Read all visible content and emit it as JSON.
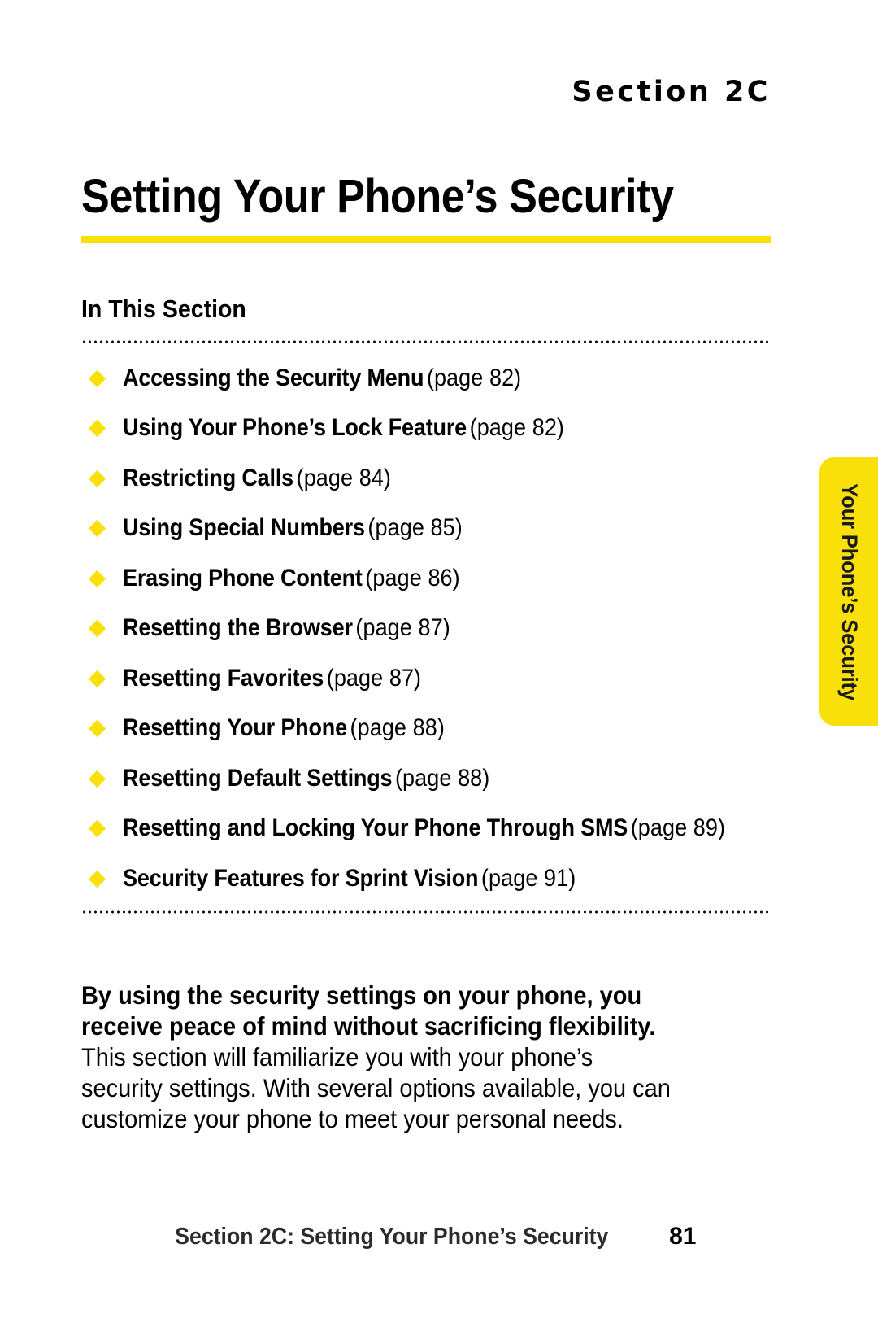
{
  "header": {
    "section_eyebrow": "Section 2C"
  },
  "title": {
    "text": "Setting Your Phone’s Security",
    "rule_color": "#FAE009"
  },
  "in_this_section": {
    "heading": "In This Section",
    "bullet_color": "#FAE009",
    "items": [
      {
        "label": "Accessing the Security Menu",
        "page_ref": "(page 82)"
      },
      {
        "label": "Using Your Phone’s Lock Feature",
        "page_ref": "(page 82)"
      },
      {
        "label": "Restricting Calls",
        "page_ref": "(page 84)"
      },
      {
        "label": "Using Special Numbers",
        "page_ref": "(page 85)"
      },
      {
        "label": "Erasing Phone Content",
        "page_ref": "(page 86)"
      },
      {
        "label": "Resetting the Browser",
        "page_ref": "(page 87)"
      },
      {
        "label": "Resetting Favorites",
        "page_ref": "(page 87)"
      },
      {
        "label": "Resetting Your Phone",
        "page_ref": "(page 88)"
      },
      {
        "label": "Resetting Default Settings",
        "page_ref": "(page 88)"
      },
      {
        "label": "Resetting and Locking Your Phone Through SMS",
        "page_ref": "(page 89)"
      },
      {
        "label": "Security Features for Sprint Vision",
        "page_ref": "(page 91)"
      }
    ]
  },
  "body": {
    "lead": "By using the security settings on your phone, you receive peace of mind without sacrificing flexibility.",
    "rest": " This section will familiarize you with your phone’s security settings. With several options available, you can customize your phone to meet your personal needs."
  },
  "side_tab": {
    "label": "Your Phone’s Security",
    "color": "#FAE009"
  },
  "footer": {
    "text": "Section 2C: Setting Your Phone’s Security",
    "page_number": "81"
  }
}
